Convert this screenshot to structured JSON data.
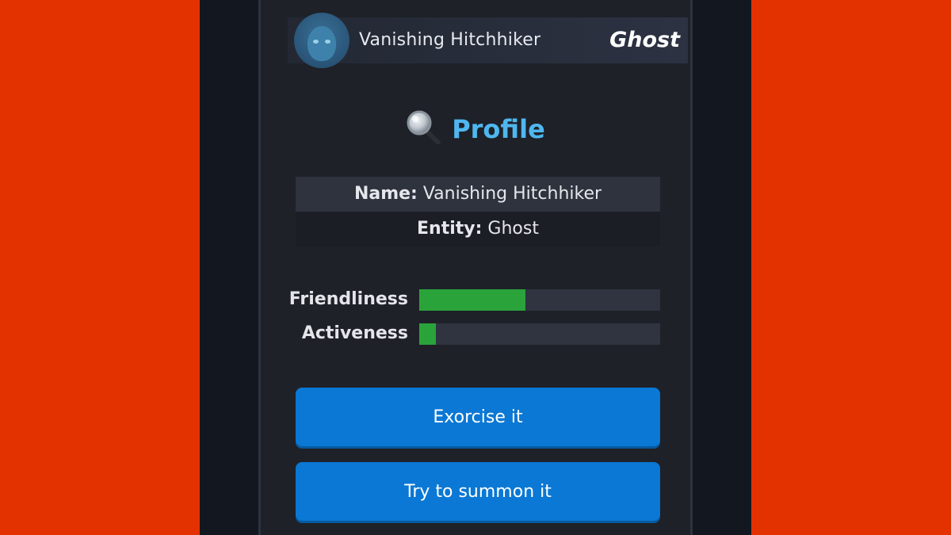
{
  "entity_header": {
    "name": "Vanishing Hitchhiker",
    "type": "Ghost",
    "avatar_icon": "ghost-portrait-icon"
  },
  "profile": {
    "title": "Profile",
    "title_icon": "magnifying-glass-icon",
    "rows": [
      {
        "key": "Name:",
        "value": "Vanishing Hitchhiker"
      },
      {
        "key": "Entity:",
        "value": "Ghost"
      }
    ]
  },
  "stats": [
    {
      "label": "Friendliness",
      "level": 0.44
    },
    {
      "label": "Activeness",
      "level": 0.07
    }
  ],
  "actions": {
    "exorcise_label": "Exorcise it",
    "summon_label": "Try to summon it"
  },
  "colors": {
    "accent_title": "#4fb7f0",
    "button": "#0a78d4",
    "stat_fill": "#2ba33b",
    "background_side": "#e43100"
  }
}
